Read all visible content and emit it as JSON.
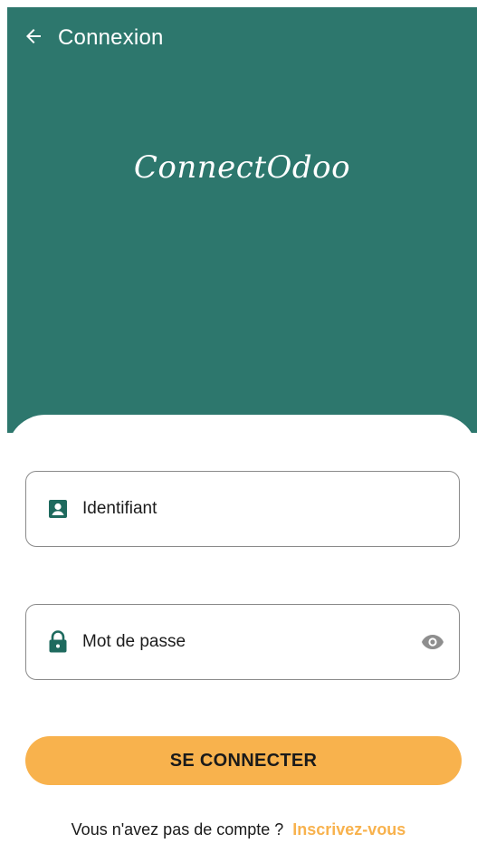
{
  "topbar": {
    "back_icon": "arrow-left-icon",
    "title": "Connexion"
  },
  "brand": {
    "name": "ConnectOdoo"
  },
  "form": {
    "login": {
      "icon": "account-box-icon",
      "placeholder": "Identifiant"
    },
    "password": {
      "icon": "lock-icon",
      "placeholder": "Mot de passe",
      "toggle_icon": "eye-icon"
    },
    "submit_label": "SE CONNECTER"
  },
  "signup": {
    "prompt": "Vous n'avez pas de compte ?",
    "link": "Inscrivez-vous"
  },
  "colors": {
    "header": "#2d776d",
    "accent": "#f8b24d",
    "icon": "#1e6a5e",
    "muted_icon": "#8e8e8e"
  }
}
